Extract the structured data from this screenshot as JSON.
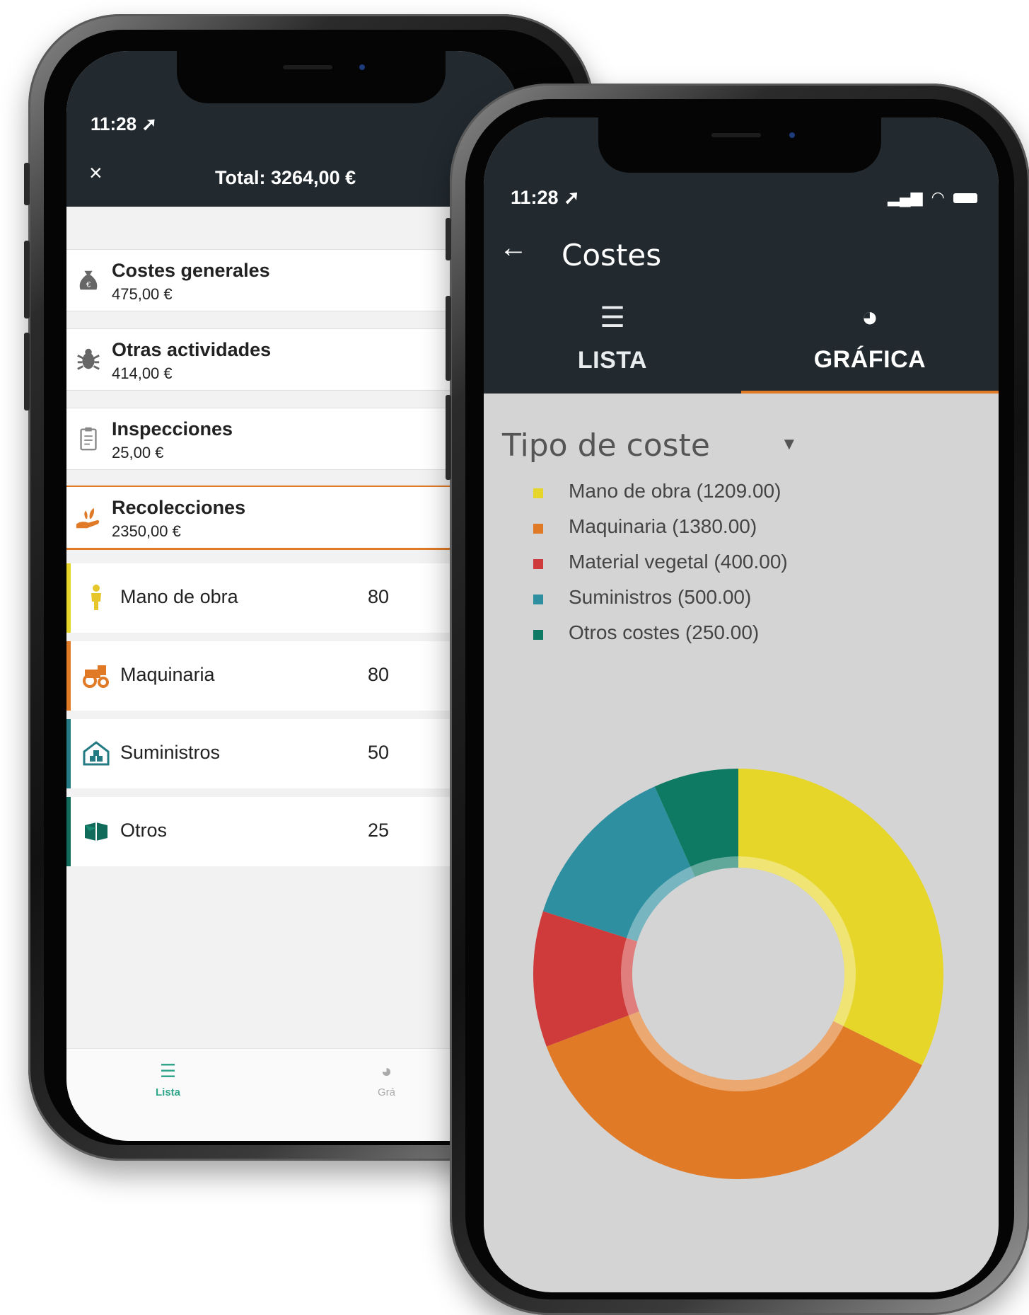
{
  "back_phone": {
    "status_time": "11:28",
    "header": {
      "close_icon": "×",
      "total": "Total: 3264,00 €"
    },
    "categories": [
      {
        "name": "Costes generales",
        "amount": "475,00 €"
      },
      {
        "name": "Otras actividades",
        "amount": "414,00 €"
      },
      {
        "name": "Inspecciones",
        "amount": "25,00 €"
      },
      {
        "name": "Recolecciones",
        "amount": "2350,00 €"
      }
    ],
    "subitems": [
      {
        "name": "Mano de obra",
        "value": "80",
        "color": "#e6d62a"
      },
      {
        "name": "Maquinaria",
        "value": "80",
        "color": "#e07a26"
      },
      {
        "name": "Suministros",
        "value": "50",
        "color": "#237a82"
      },
      {
        "name": "Otros",
        "value": "25",
        "color": "#116b5a"
      }
    ],
    "tabbar": {
      "lista": "Lista",
      "grafica": "Grá"
    }
  },
  "front_phone": {
    "status_time": "11:28",
    "title": "Costes",
    "tabs": {
      "lista": "LISTA",
      "grafica": "GRÁFICA"
    },
    "dropdown_label": "Tipo de coste",
    "legend": [
      {
        "label": "Mano de obra (1209.00)",
        "color": "#e6d62a"
      },
      {
        "label": "Maquinaria (1380.00)",
        "color": "#e07a26"
      },
      {
        "label": "Material vegetal (400.00)",
        "color": "#cf3a3a"
      },
      {
        "label": "Suministros (500.00)",
        "color": "#2e8fa0"
      },
      {
        "label": "Otros costes (250.00)",
        "color": "#0e7a64"
      }
    ]
  },
  "chart_data": {
    "type": "pie",
    "title": "",
    "categories": [
      "Mano de obra",
      "Maquinaria",
      "Material vegetal",
      "Suministros",
      "Otros costes"
    ],
    "values": [
      1209.0,
      1380.0,
      400.0,
      500.0,
      250.0
    ],
    "colors": [
      "#e6d62a",
      "#e07a26",
      "#cf3a3a",
      "#2e8fa0",
      "#0e7a64"
    ],
    "donut": true,
    "legend_position": "top-left"
  }
}
